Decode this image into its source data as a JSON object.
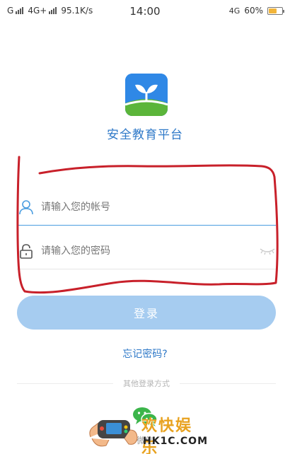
{
  "status_bar": {
    "carrier1": "G",
    "carrier2": "4G+",
    "speed": "95.1K/s",
    "time": "14:00",
    "network_right": "4G",
    "battery_percent": "60%",
    "battery_level": 0.6,
    "battery_color": "#f2b53a"
  },
  "app": {
    "logo_icon": "sprout-logo-icon",
    "title": "安全教育平台"
  },
  "form": {
    "account_placeholder": "请输入您的帐号",
    "account_value": "",
    "password_placeholder": "请输入您的密码",
    "password_value": "",
    "login_label": "登录",
    "forgot_label": "忘记密码?"
  },
  "other_login": {
    "divider_text": "其他登录方式",
    "wechat_label": "微信",
    "wechat_icon": "wechat-icon"
  },
  "watermark": {
    "title": "欢快娱乐",
    "site": "HK1C.COM"
  },
  "colors": {
    "accent": "#2f79c8",
    "login_button": "#a6ccf0",
    "annotation": "#c8202a"
  }
}
